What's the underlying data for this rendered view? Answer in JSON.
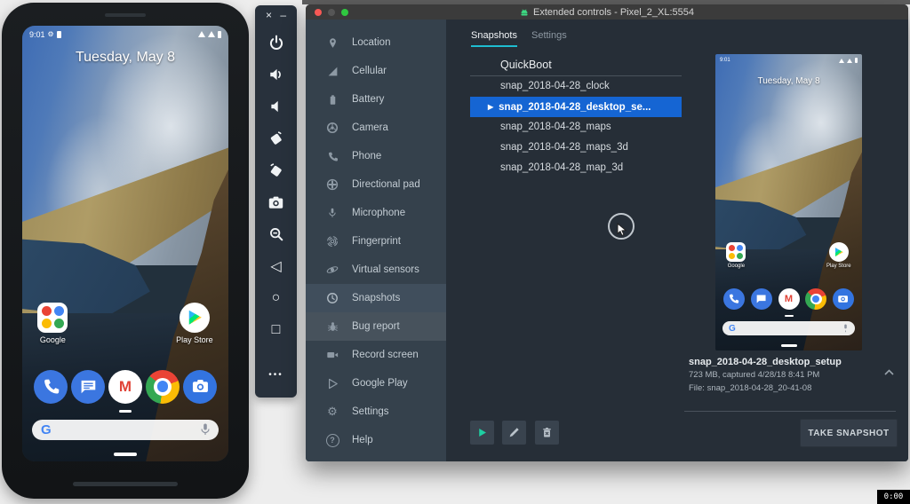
{
  "recording": {
    "time": "0:00"
  },
  "phone": {
    "status_clock": "9:01",
    "date": "Tuesday, May 8",
    "folder_label": "Google",
    "play_store_label": "Play Store",
    "search_logo": "G"
  },
  "toolbar": {
    "close": "×",
    "minimize": "–",
    "back": "◁",
    "home": "○",
    "overview": "□",
    "more": "•••"
  },
  "window": {
    "title": "Extended controls - Pixel_2_XL:5554",
    "tabs": [
      {
        "label": "Snapshots"
      },
      {
        "label": "Settings"
      }
    ],
    "sidebar": [
      {
        "label": "Location",
        "icon": "location-pin"
      },
      {
        "label": "Cellular",
        "icon": "cellular-signal"
      },
      {
        "label": "Battery",
        "icon": "battery"
      },
      {
        "label": "Camera",
        "icon": "camera-aperture"
      },
      {
        "label": "Phone",
        "icon": "phone-handset"
      },
      {
        "label": "Directional pad",
        "icon": "dpad"
      },
      {
        "label": "Microphone",
        "icon": "microphone"
      },
      {
        "label": "Fingerprint",
        "icon": "fingerprint"
      },
      {
        "label": "Virtual sensors",
        "icon": "virtual-sensors"
      },
      {
        "label": "Snapshots",
        "icon": "snapshots-history",
        "selected": true
      },
      {
        "label": "Bug report",
        "icon": "bug"
      },
      {
        "label": "Record screen",
        "icon": "video-camera"
      },
      {
        "label": "Google Play",
        "icon": "google-play"
      },
      {
        "label": "Settings",
        "icon": "gear"
      },
      {
        "label": "Help",
        "icon": "help-circle"
      }
    ],
    "snapshots": {
      "header": "QuickBoot",
      "selected_index": 1,
      "selected_arrow": "▶",
      "items": [
        "snap_2018-04-28_clock",
        "snap_2018-04-28_desktop_se...",
        "snap_2018-04-28_maps",
        "snap_2018-04-28_maps_3d",
        "snap_2018-04-28_map_3d"
      ]
    },
    "details": {
      "name": "snap_2018-04-28_desktop_setup",
      "meta": "723 MB, captured 4/28/18 8:41 PM",
      "file": "File: snap_2018-04-28_20-41-08"
    },
    "actions": {
      "take_snapshot": "TAKE SNAPSHOT"
    }
  },
  "colors": {
    "selection_blue": "#1565d3",
    "accent_teal": "#1ebdd0",
    "play_green": "#1ecfa2"
  }
}
